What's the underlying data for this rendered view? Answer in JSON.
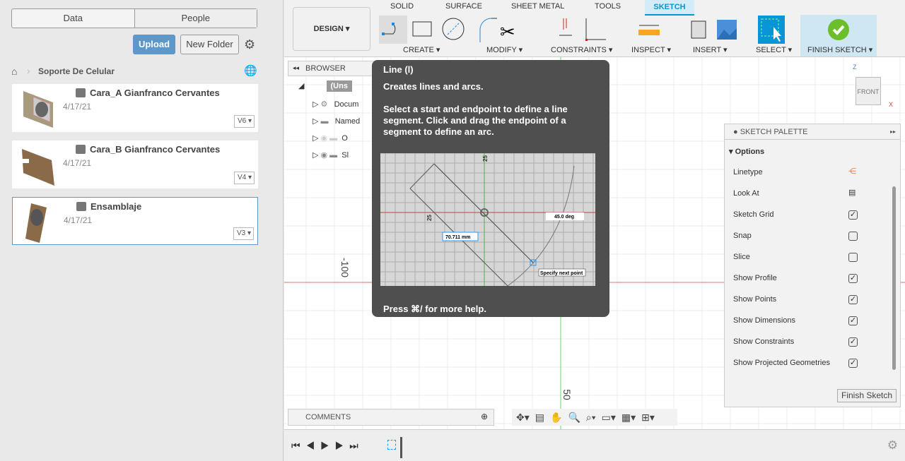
{
  "data_panel": {
    "tabs": [
      "Data",
      "People"
    ],
    "upload": "Upload",
    "new_folder": "New Folder",
    "breadcrumb": "Soporte De Celular",
    "files": [
      {
        "name": "Cara_A Gianfranco Cervantes",
        "date": "4/17/21",
        "version": "V6"
      },
      {
        "name": "Cara_B Gianfranco Cervantes",
        "date": "4/17/21",
        "version": "V4"
      },
      {
        "name": "Ensamblaje",
        "date": "4/17/21",
        "version": "V3",
        "selected": true
      }
    ]
  },
  "toolbar": {
    "workspace": "DESIGN",
    "tabs": [
      "SOLID",
      "SURFACE",
      "SHEET METAL",
      "TOOLS",
      "SKETCH"
    ],
    "active_tab": "SKETCH",
    "groups": [
      "CREATE",
      "MODIFY",
      "CONSTRAINTS",
      "INSPECT",
      "INSERT",
      "SELECT",
      "FINISH SKETCH"
    ]
  },
  "browser": {
    "title": "BROWSER",
    "items": [
      "(Uns",
      "Docum",
      "Named",
      "O",
      "Sl"
    ]
  },
  "tooltip": {
    "title": "Line (l)",
    "subtitle": "Creates lines and arcs.",
    "body": "Select a start and endpoint to define a line segment. Click and drag the endpoint of a segment to define an arc.",
    "image_labels": {
      "dimension": "70.711 mm",
      "angle": "45.0 deg",
      "prompt": "Specify next point",
      "tick_a": "25",
      "tick_b": "25"
    },
    "footer": "Press ⌘/ for more help."
  },
  "canvas": {
    "axis_labels": [
      "-100",
      "50"
    ],
    "viewcube": "FRONT",
    "axis_z": "Z",
    "axis_x": "X"
  },
  "sketch_palette": {
    "title": "SKETCH PALETTE",
    "section": "Options",
    "options": [
      {
        "label": "Linetype",
        "type": "icon"
      },
      {
        "label": "Look At",
        "type": "icon"
      },
      {
        "label": "Sketch Grid",
        "checked": true
      },
      {
        "label": "Snap",
        "checked": false
      },
      {
        "label": "Slice",
        "checked": false
      },
      {
        "label": "Show Profile",
        "checked": true
      },
      {
        "label": "Show Points",
        "checked": true
      },
      {
        "label": "Show Dimensions",
        "checked": true
      },
      {
        "label": "Show Constraints",
        "checked": true
      },
      {
        "label": "Show Projected Geometries",
        "checked": true
      }
    ],
    "finish": "Finish Sketch"
  },
  "comments": {
    "title": "COMMENTS"
  },
  "colors": {
    "accent": "#0696d7",
    "finish_green": "#6cbf2a",
    "upload": "#5e97c9"
  }
}
